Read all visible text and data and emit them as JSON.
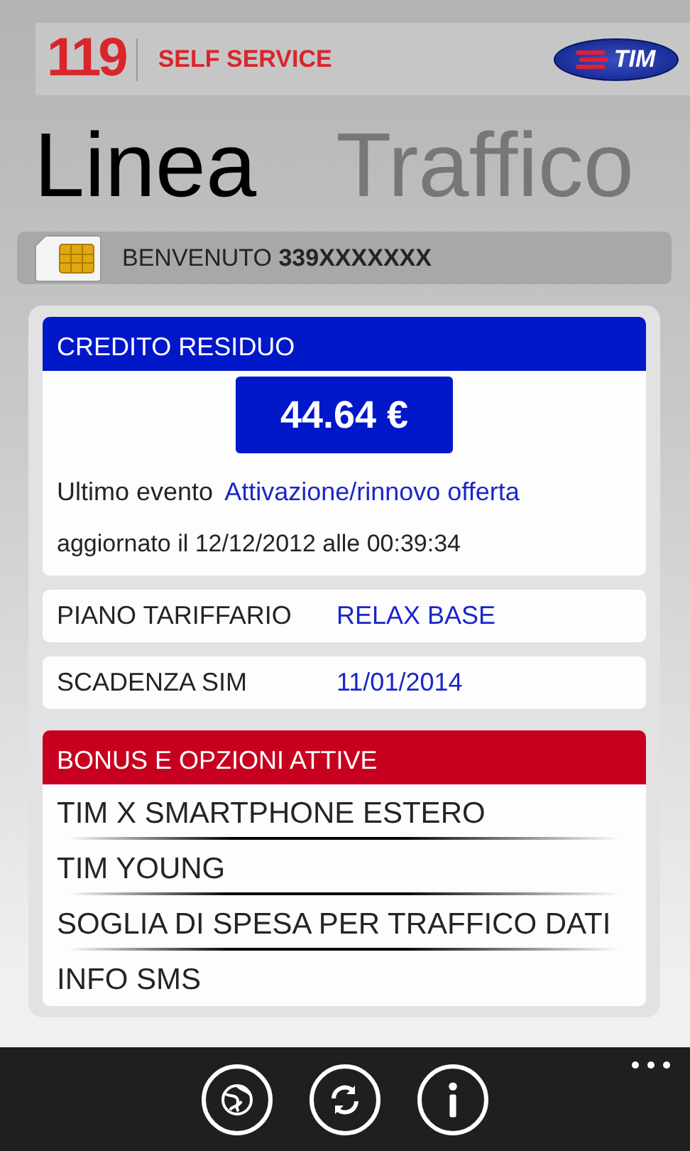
{
  "header": {
    "logo_number": "119",
    "logo_text": "SELF SERVICE",
    "brand": "TIM"
  },
  "pivot": [
    {
      "label": "Linea",
      "selected": true
    },
    {
      "label": "Traffico",
      "selected": false
    }
  ],
  "welcome": {
    "label": "BENVENUTO",
    "number": "339XXXXXXX"
  },
  "credit": {
    "title": "CREDITO RESIDUO",
    "amount": "44.64 €",
    "last_event_label": "Ultimo evento",
    "last_event": "Attivazione/rinnovo offerta",
    "updated": "aggiornato il 12/12/2012 alle 00:39:34"
  },
  "info_rows": [
    {
      "label": "PIANO TARIFFARIO",
      "value": "RELAX BASE"
    },
    {
      "label": "SCADENZA SIM",
      "value": "11/01/2014"
    }
  ],
  "bonus": {
    "title": "BONUS E OPZIONI ATTIVE",
    "items": [
      "TIM X SMARTPHONE ESTERO",
      "TIM YOUNG",
      "SOGLIA DI SPESA PER TRAFFICO DATI",
      "INFO SMS"
    ]
  },
  "app_bar": [
    {
      "kind": "globe"
    },
    {
      "kind": "refresh"
    },
    {
      "kind": "info"
    }
  ]
}
